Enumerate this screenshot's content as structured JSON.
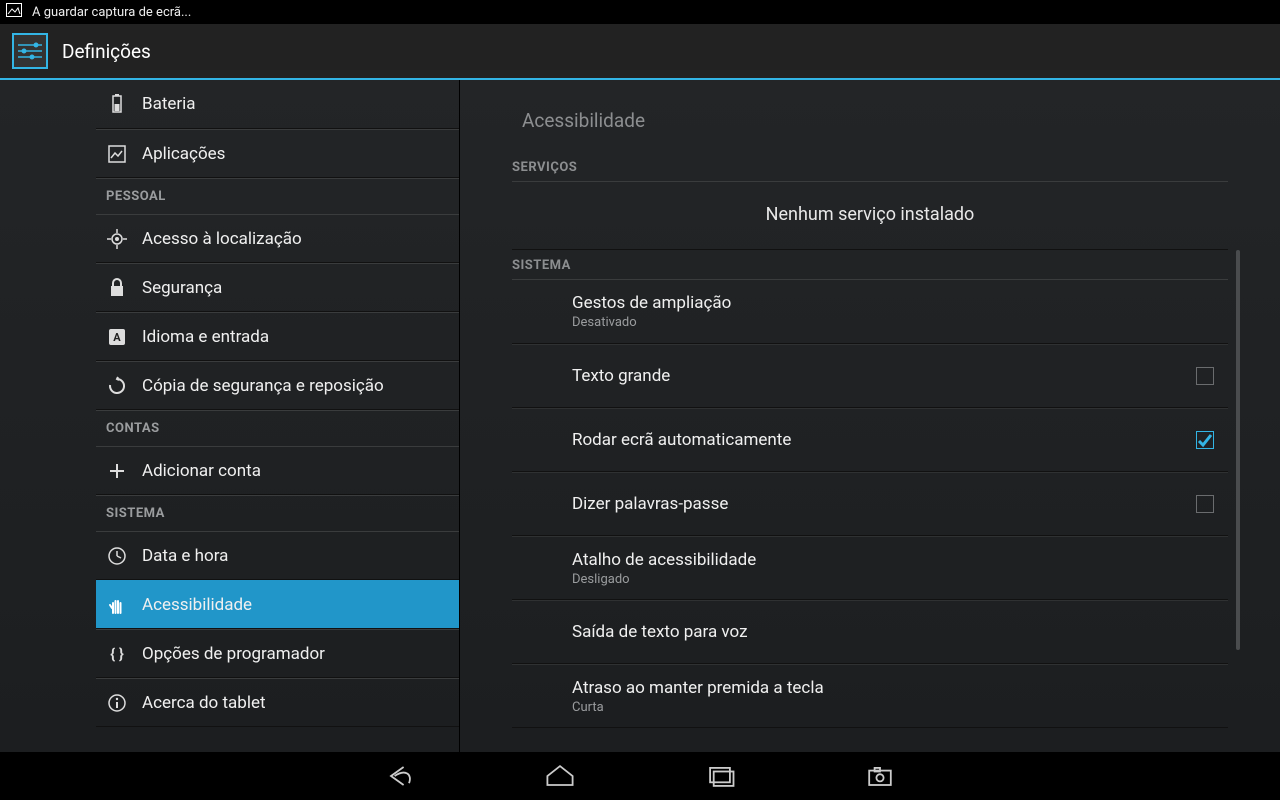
{
  "status": {
    "saving_text": "A guardar captura de ecrã..."
  },
  "action_bar": {
    "title": "Definições"
  },
  "sidebar": {
    "items_top": [
      {
        "label": "Bateria",
        "name": "sidebar-item-bateria"
      },
      {
        "label": "Aplicações",
        "name": "sidebar-item-aplicacoes"
      }
    ],
    "header_pessoal": "PESSOAL",
    "items_pessoal": [
      {
        "label": "Acesso à localização",
        "name": "sidebar-item-localizacao"
      },
      {
        "label": "Segurança",
        "name": "sidebar-item-seguranca"
      },
      {
        "label": "Idioma e entrada",
        "name": "sidebar-item-idioma"
      },
      {
        "label": "Cópia de segurança e reposição",
        "name": "sidebar-item-backup"
      }
    ],
    "header_contas": "CONTAS",
    "add_account": "Adicionar conta",
    "header_sistema": "SISTEMA",
    "items_sistema": [
      {
        "label": "Data e hora",
        "name": "sidebar-item-data-hora"
      },
      {
        "label": "Acessibilidade",
        "name": "sidebar-item-acessibilidade",
        "active": true
      },
      {
        "label": "Opções de programador",
        "name": "sidebar-item-dev"
      },
      {
        "label": "Acerca do tablet",
        "name": "sidebar-item-about"
      }
    ]
  },
  "content": {
    "title": "Acessibilidade",
    "header_servicos": "SERVIÇOS",
    "no_service_text": "Nenhum serviço instalado",
    "header_sistema": "SISTEMA",
    "rows": [
      {
        "title": "Gestos de ampliação",
        "sub": "Desativado",
        "has_check": false
      },
      {
        "title": "Texto grande",
        "sub": "",
        "has_check": true,
        "checked": false
      },
      {
        "title": "Rodar ecrã automaticamente",
        "sub": "",
        "has_check": true,
        "checked": true
      },
      {
        "title": "Dizer palavras-passe",
        "sub": "",
        "has_check": true,
        "checked": false
      },
      {
        "title": "Atalho de acessibilidade",
        "sub": "Desligado",
        "has_check": false
      },
      {
        "title": "Saída de texto para voz",
        "sub": "",
        "has_check": false
      },
      {
        "title": "Atraso ao manter premida a tecla",
        "sub": "Curta",
        "has_check": false
      }
    ]
  }
}
